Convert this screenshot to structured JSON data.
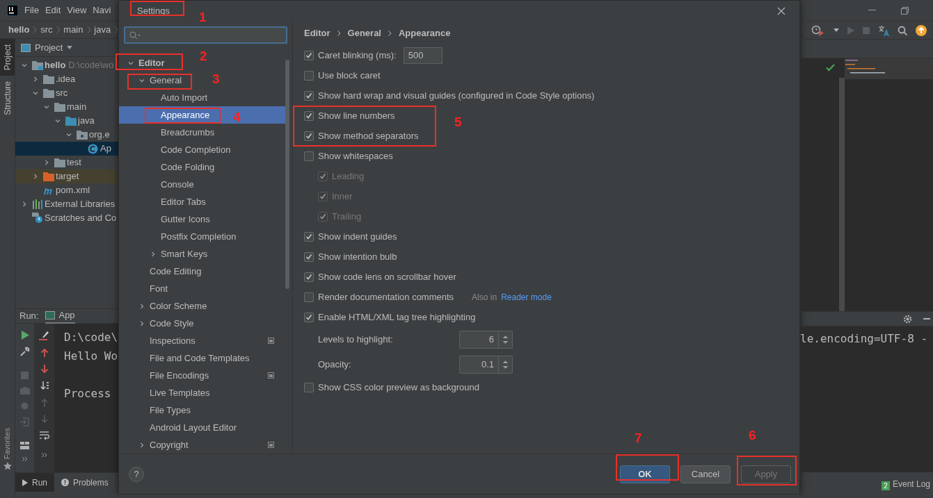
{
  "ide": {
    "menu": [
      "File",
      "Edit",
      "View",
      "Navi"
    ],
    "breadcrumb": [
      "hello",
      "src",
      "main",
      "java"
    ],
    "side_tabs": [
      {
        "label": "Project",
        "selected": true
      },
      {
        "label": "Structure",
        "selected": false
      }
    ],
    "favorites_tab": "Favorites",
    "project_header": "Project",
    "project_tree": [
      {
        "label": "hello",
        "path": "D:\\code\\wo",
        "kind": "module",
        "expanded": true,
        "selected": false,
        "children": [
          {
            "label": ".idea",
            "kind": "folder",
            "expanded": false,
            "selected": false
          },
          {
            "label": "src",
            "kind": "folder",
            "expanded": true,
            "selected": false,
            "children": [
              {
                "label": "main",
                "kind": "folder",
                "expanded": true,
                "selected": false,
                "children": [
                  {
                    "label": "java",
                    "kind": "source-folder",
                    "expanded": true,
                    "selected": false,
                    "children": [
                      {
                        "label": "org.e",
                        "kind": "package",
                        "expanded": true,
                        "selected": false,
                        "children": [
                          {
                            "label": "Ap",
                            "kind": "class",
                            "selected": true
                          }
                        ]
                      }
                    ]
                  }
                ]
              },
              {
                "label": "test",
                "kind": "folder",
                "expanded": false,
                "selected": false
              }
            ]
          },
          {
            "label": "target",
            "kind": "excluded-folder",
            "expanded": false,
            "selected": false
          },
          {
            "label": "pom.xml",
            "kind": "maven",
            "selected": false
          }
        ]
      },
      {
        "label": "External Libraries",
        "kind": "libraries",
        "expanded": false,
        "selected": false
      },
      {
        "label": "Scratches and Co",
        "kind": "scratches",
        "selected": false
      }
    ],
    "run_panel": {
      "label": "Run:",
      "tab": "App",
      "console_left": [
        "D:\\code\\",
        "Hello Wo"
      ],
      "console_status": "Process",
      "console_right": "le.encoding=UTF-8 -"
    },
    "bottom_tabs": [
      {
        "label": "Run",
        "selected": true
      },
      {
        "label": "Problems",
        "selected": false
      }
    ],
    "event_log": {
      "count": "2",
      "label": "Event Log"
    }
  },
  "dialog": {
    "title": "Settings",
    "tree": [
      {
        "label": "Editor",
        "bold": true,
        "expanded": true,
        "selected": false,
        "scope_marker": false,
        "children": [
          {
            "label": "General",
            "bold": false,
            "expanded": true,
            "selected": false,
            "scope_marker": false,
            "children": [
              {
                "label": "Auto Import",
                "bold": false,
                "selected": false,
                "scope_marker": false
              },
              {
                "label": "Appearance",
                "bold": false,
                "selected": true,
                "scope_marker": false
              },
              {
                "label": "Breadcrumbs",
                "bold": false,
                "selected": false,
                "scope_marker": false
              },
              {
                "label": "Code Completion",
                "bold": false,
                "selected": false,
                "scope_marker": false
              },
              {
                "label": "Code Folding",
                "bold": false,
                "selected": false,
                "scope_marker": false
              },
              {
                "label": "Console",
                "bold": false,
                "selected": false,
                "scope_marker": false
              },
              {
                "label": "Editor Tabs",
                "bold": false,
                "selected": false,
                "scope_marker": false
              },
              {
                "label": "Gutter Icons",
                "bold": false,
                "selected": false,
                "scope_marker": false
              },
              {
                "label": "Postfix Completion",
                "bold": false,
                "selected": false,
                "scope_marker": false
              },
              {
                "label": "Smart Keys",
                "bold": false,
                "expanded": false,
                "selected": false,
                "scope_marker": false
              }
            ]
          },
          {
            "label": "Code Editing",
            "bold": false,
            "selected": false,
            "scope_marker": false
          },
          {
            "label": "Font",
            "bold": false,
            "selected": false,
            "scope_marker": false
          },
          {
            "label": "Color Scheme",
            "bold": false,
            "expanded": false,
            "selected": false,
            "scope_marker": false
          },
          {
            "label": "Code Style",
            "bold": false,
            "expanded": false,
            "selected": false,
            "scope_marker": false
          },
          {
            "label": "Inspections",
            "bold": false,
            "selected": false,
            "scope_marker": true
          },
          {
            "label": "File and Code Templates",
            "bold": false,
            "selected": false,
            "scope_marker": false
          },
          {
            "label": "File Encodings",
            "bold": false,
            "selected": false,
            "scope_marker": true
          },
          {
            "label": "Live Templates",
            "bold": false,
            "selected": false,
            "scope_marker": false
          },
          {
            "label": "File Types",
            "bold": false,
            "selected": false,
            "scope_marker": false
          },
          {
            "label": "Android Layout Editor",
            "bold": false,
            "selected": false,
            "scope_marker": false
          },
          {
            "label": "Copyright",
            "bold": false,
            "expanded": false,
            "selected": false,
            "scope_marker": true
          }
        ]
      }
    ],
    "breadcrumb": [
      "Editor",
      "General",
      "Appearance"
    ],
    "options": [
      {
        "kind": "checkbox_field",
        "label": "Caret blinking (ms):",
        "checked": true,
        "disabled": false,
        "value": "500"
      },
      {
        "kind": "checkbox",
        "label": "Use block caret",
        "checked": false,
        "disabled": false
      },
      {
        "kind": "checkbox",
        "label": "Show hard wrap and visual guides (configured in Code Style options)",
        "checked": true,
        "disabled": false
      },
      {
        "kind": "checkbox",
        "label": "Show line numbers",
        "checked": true,
        "disabled": false
      },
      {
        "kind": "checkbox",
        "label": "Show method separators",
        "checked": true,
        "disabled": false
      },
      {
        "kind": "checkbox",
        "label": "Show whitespaces",
        "checked": false,
        "disabled": false,
        "children": [
          {
            "kind": "checkbox",
            "label": "Leading",
            "checked": true,
            "disabled": true
          },
          {
            "kind": "checkbox",
            "label": "Inner",
            "checked": true,
            "disabled": true
          },
          {
            "kind": "checkbox",
            "label": "Trailing",
            "checked": true,
            "disabled": true
          }
        ]
      },
      {
        "kind": "checkbox",
        "label": "Show indent guides",
        "checked": true,
        "disabled": false
      },
      {
        "kind": "checkbox",
        "label": "Show intention bulb",
        "checked": true,
        "disabled": false
      },
      {
        "kind": "checkbox",
        "label": "Show code lens on scrollbar hover",
        "checked": true,
        "disabled": false
      },
      {
        "kind": "checkbox_hint",
        "label": "Render documentation comments",
        "checked": false,
        "disabled": false,
        "hint": "Also in",
        "link": "Reader mode"
      },
      {
        "kind": "checkbox",
        "label": "Enable HTML/XML tag tree highlighting",
        "checked": true,
        "disabled": false,
        "children": [
          {
            "kind": "spinner",
            "label": "Levels to highlight:",
            "value": "6"
          },
          {
            "kind": "spinner",
            "label": "Opacity:",
            "value": "0.1"
          }
        ]
      },
      {
        "kind": "checkbox",
        "label": "Show CSS color preview as background",
        "checked": false,
        "disabled": false
      }
    ],
    "help": "?",
    "buttons": [
      {
        "label": "OK",
        "kind": "primary",
        "disabled": false
      },
      {
        "label": "Cancel",
        "kind": "normal",
        "disabled": false
      },
      {
        "label": "Apply",
        "kind": "normal",
        "disabled": true
      }
    ]
  },
  "annotations": [
    "1",
    "2",
    "3",
    "4",
    "5",
    "6",
    "7"
  ]
}
